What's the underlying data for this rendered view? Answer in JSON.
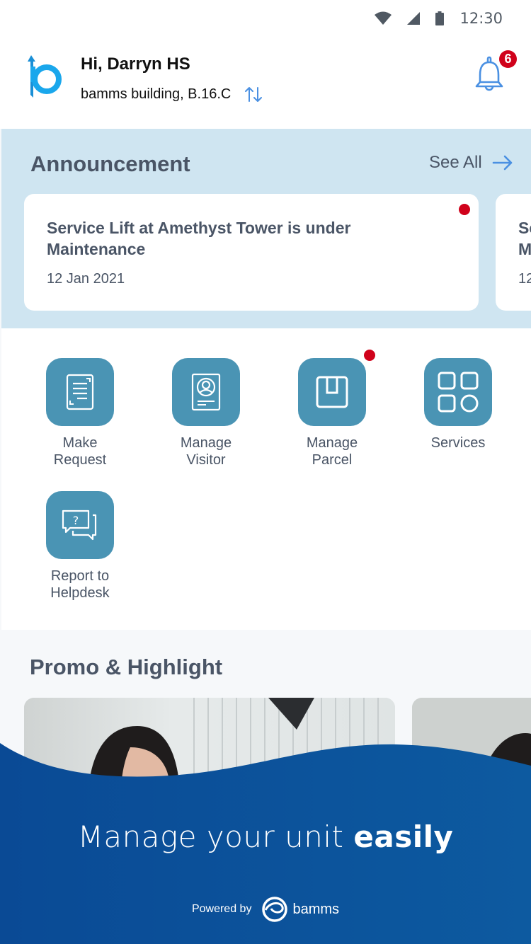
{
  "status_bar": {
    "time": "12:30",
    "icons": [
      "wifi-icon",
      "cellular-signal-icon",
      "battery-icon"
    ]
  },
  "header": {
    "logo": "bamms-b-logo",
    "greeting": "Hi, Darryn HS",
    "building": "bamms building, B.16.C",
    "switch_icon": "swap-vertical-icon",
    "notifications": {
      "icon": "bell-icon",
      "count": "6"
    }
  },
  "colors": {
    "accent_blue": "#4a90e2",
    "tile_teal": "#4a94b4",
    "alert_red": "#d0021b",
    "announcement_bg": "#cfe5f1",
    "footer_blue": "#0a4c96",
    "text_slate": "#4a5566"
  },
  "announcement": {
    "title": "Announcement",
    "see_all": "See All",
    "items": [
      {
        "title": "Service Lift at Amethyst Tower is under Maintenance",
        "date": "12 Jan 2021",
        "unread": true
      },
      {
        "title": "Se M",
        "date": "12",
        "unread": false
      }
    ]
  },
  "menu": {
    "items": [
      {
        "label_line1": "Make",
        "label_line2": "Request",
        "icon": "document-icon",
        "has_dot": false
      },
      {
        "label_line1": "Manage",
        "label_line2": "Visitor",
        "icon": "visitor-id-card-icon",
        "has_dot": false
      },
      {
        "label_line1": "Manage",
        "label_line2": "Parcel",
        "icon": "parcel-box-icon",
        "has_dot": true
      },
      {
        "label_line1": "Services",
        "label_line2": "",
        "icon": "services-grid-icon",
        "has_dot": false
      },
      {
        "label_line1": "Report to",
        "label_line2": "Helpdesk",
        "icon": "helpdesk-chat-icon",
        "has_dot": false
      }
    ]
  },
  "promo": {
    "title": "Promo & Highlight",
    "cards": [
      "promo-photo-woman-1",
      "promo-photo-woman-2"
    ]
  },
  "footer": {
    "tagline_regular": "Manage your unit ",
    "tagline_bold": "easily",
    "powered_by": "Powered by",
    "brand": "bamms"
  }
}
